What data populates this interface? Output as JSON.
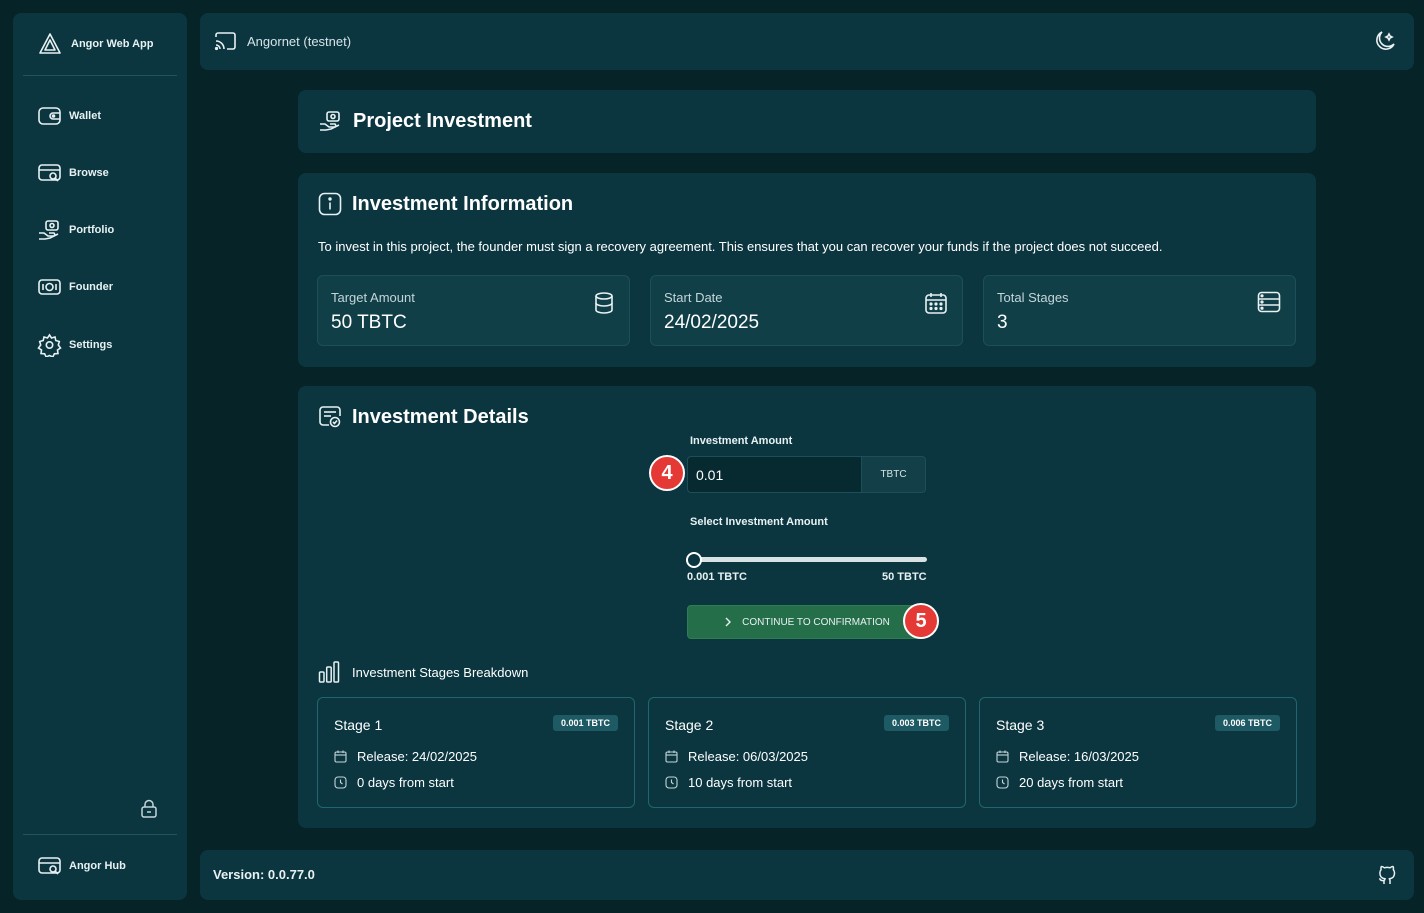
{
  "app": {
    "title": "Angor Web App"
  },
  "sidebar": {
    "items": [
      {
        "label": "Wallet",
        "icon": "wallet-icon"
      },
      {
        "label": "Browse",
        "icon": "browse-icon"
      },
      {
        "label": "Portfolio",
        "icon": "portfolio-icon"
      },
      {
        "label": "Founder",
        "icon": "founder-icon"
      },
      {
        "label": "Settings",
        "icon": "settings-icon"
      }
    ],
    "hub_label": "Angor Hub"
  },
  "topbar": {
    "network": "Angornet (testnet)"
  },
  "page": {
    "title": "Project Investment"
  },
  "info": {
    "title": "Investment Information",
    "description": "To invest in this project, the founder must sign a recovery agreement. This ensures that you can recover your funds if the project does not succeed.",
    "cards": [
      {
        "label": "Target Amount",
        "value": "50 TBTC",
        "icon": "database-icon"
      },
      {
        "label": "Start Date",
        "value": "24/02/2025",
        "icon": "calendar-icon"
      },
      {
        "label": "Total Stages",
        "value": "3",
        "icon": "stages-icon"
      }
    ]
  },
  "details": {
    "title": "Investment Details",
    "amount_label": "Investment Amount",
    "amount_value": "0.01",
    "unit": "TBTC",
    "slider_label": "Select Investment Amount",
    "slider_min": "0.001 TBTC",
    "slider_max": "50 TBTC",
    "slider_fraction": 0.0002,
    "continue_label": "CONTINUE TO CONFIRMATION",
    "badges": [
      "4",
      "5"
    ],
    "breakdown_title": "Investment Stages Breakdown",
    "stages": [
      {
        "name": "Stage 1",
        "amount": "0.001 TBTC",
        "release": "Release: 24/02/2025",
        "days": "0 days from start"
      },
      {
        "name": "Stage 2",
        "amount": "0.003 TBTC",
        "release": "Release: 06/03/2025",
        "days": "10 days from start"
      },
      {
        "name": "Stage 3",
        "amount": "0.006 TBTC",
        "release": "Release: 16/03/2025",
        "days": "20 days from start"
      }
    ]
  },
  "footer": {
    "version": "Version: 0.0.77.0"
  },
  "colors": {
    "background": "#062328",
    "panel": "#0b3640",
    "accent_green": "#256e4a",
    "badge_red": "#e53935"
  }
}
